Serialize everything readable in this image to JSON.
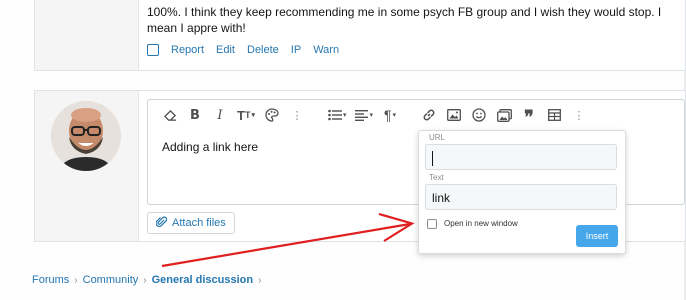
{
  "top_post": {
    "body": "100%. I think they keep recommending me in some psych FB group and I wish they would stop. I mean I appre with!",
    "actions": [
      "Report",
      "Edit",
      "Delete",
      "IP",
      "Warn"
    ]
  },
  "editor": {
    "content": "Adding a link here",
    "attach_label": "Attach files",
    "toolbar_icons": [
      "eraser-icon",
      "bold-icon",
      "italic-icon",
      "text-size-icon",
      "palette-icon",
      "more-icon",
      "list-icon",
      "align-icon",
      "paragraph-icon",
      "link-icon",
      "image-icon",
      "smilie-icon",
      "media-icon",
      "quote-icon",
      "table-icon",
      "more-icon"
    ]
  },
  "link_popup": {
    "url_label": "URL",
    "url_value": "",
    "text_label": "Text",
    "text_value": "link",
    "new_window_label": "Open in new window",
    "insert_label": "Insert"
  },
  "breadcrumb": {
    "items": [
      "Forums",
      "Community",
      "General discussion"
    ]
  },
  "colors": {
    "link": "#2577b1",
    "insert_button": "#47a7eb",
    "arrow": "#e02020"
  }
}
